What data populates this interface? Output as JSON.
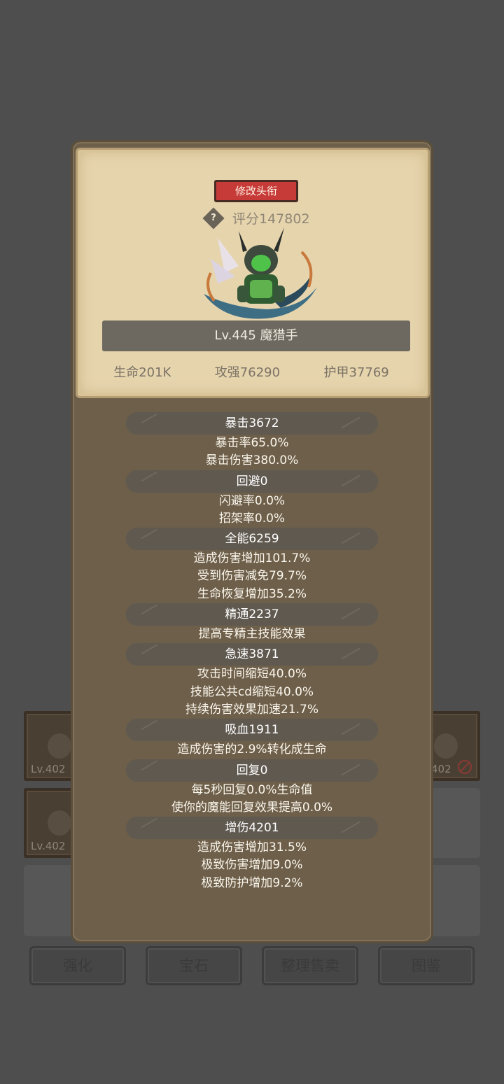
{
  "background": {
    "slots": [
      {
        "level": "Lv.402"
      },
      {
        "level": "Lv.402"
      },
      {
        "level": "402"
      }
    ],
    "buttons": [
      "强化",
      "宝石",
      "整理售卖",
      "图鉴"
    ]
  },
  "dialog": {
    "title_button": "修改头衔",
    "help_icon": "?",
    "score": "评分147802",
    "hero_name": "Lv.445 魔猎手",
    "base_stats": {
      "life": "生命201K",
      "attack": "攻强76290",
      "armor": "护甲37769"
    },
    "stat_groups": [
      {
        "head": "暴击3672",
        "lines": [
          "暴击率65.0%",
          "暴击伤害380.0%"
        ]
      },
      {
        "head": "回避0",
        "lines": [
          "闪避率0.0%",
          "招架率0.0%"
        ]
      },
      {
        "head": "全能6259",
        "lines": [
          "造成伤害增加101.7%",
          "受到伤害减免79.7%",
          "生命恢复增加35.2%"
        ]
      },
      {
        "head": "精通2237",
        "lines": [
          "提高专精主技能效果"
        ]
      },
      {
        "head": "急速3871",
        "lines": [
          "攻击时间缩短40.0%",
          "技能公共cd缩短40.0%",
          "持续伤害效果加速21.7%"
        ]
      },
      {
        "head": "吸血1911",
        "lines": [
          "造成伤害的2.9%转化成生命"
        ]
      },
      {
        "head": "回复0",
        "lines": [
          "每5秒回复0.0%生命值",
          "使你的魔能回复效果提高0.0%"
        ]
      },
      {
        "head": "增伤4201",
        "lines": [
          "造成伤害增加31.5%",
          "极致伤害增加9.0%",
          "极致防护增加9.2%"
        ]
      }
    ]
  }
}
